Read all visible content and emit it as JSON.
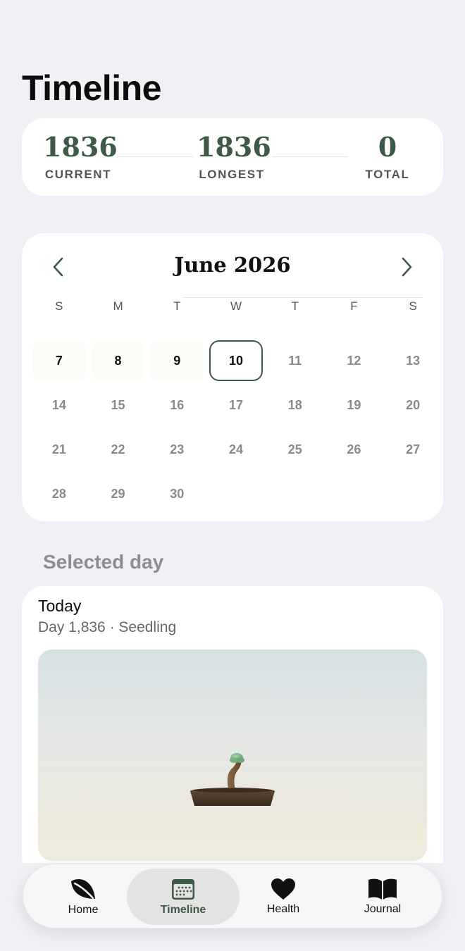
{
  "page": {
    "title": "Timeline"
  },
  "stats": {
    "current": {
      "value": "1836",
      "label": "CURRENT"
    },
    "longest": {
      "value": "1836",
      "label": "LONGEST"
    },
    "total": {
      "value": "0",
      "label": "TOTAL"
    }
  },
  "calendar": {
    "month_label": "June 2026",
    "weekdays": [
      "S",
      "M",
      "T",
      "W",
      "T",
      "F",
      "S"
    ],
    "leading_blanks": 0,
    "days": [
      "7",
      "8",
      "9",
      "10",
      "11",
      "12",
      "13",
      "14",
      "15",
      "16",
      "17",
      "18",
      "19",
      "20",
      "21",
      "22",
      "23",
      "24",
      "25",
      "26",
      "27",
      "28",
      "29",
      "30"
    ],
    "past_days": [
      "7",
      "8",
      "9"
    ],
    "today": "10"
  },
  "selected_day": {
    "section_label": "Selected day",
    "title": "Today",
    "subtitle": "Day 1,836 · Seedling"
  },
  "tabs": [
    {
      "label": "Home",
      "icon": "leaf-icon",
      "active": false
    },
    {
      "label": "Timeline",
      "icon": "calendar-icon",
      "active": true
    },
    {
      "label": "Health",
      "icon": "heart-icon",
      "active": false
    },
    {
      "label": "Journal",
      "icon": "book-icon",
      "active": false
    }
  ],
  "colors": {
    "accent": "#3d5a47",
    "background": "#f1f1f5",
    "card": "#ffffff"
  }
}
